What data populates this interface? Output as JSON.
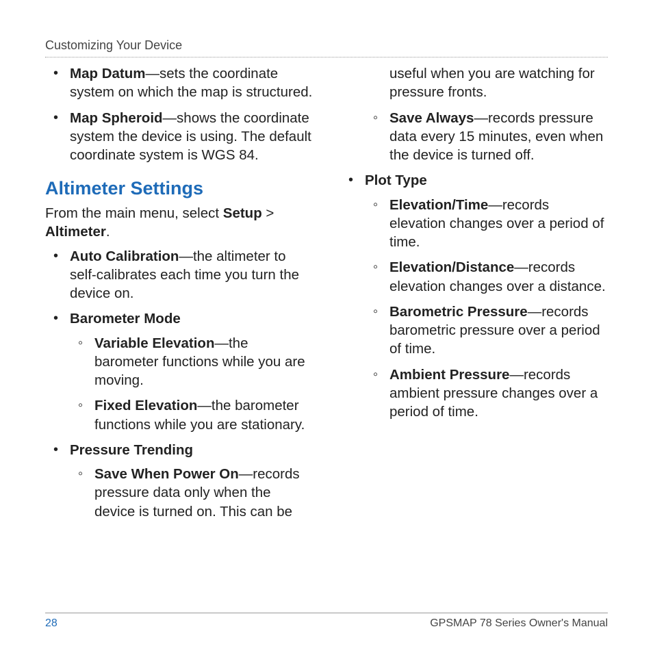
{
  "header": {
    "breadcrumb": "Customizing Your Device"
  },
  "left": {
    "map_datum_term": "Map Datum",
    "map_datum_desc": "—sets the coordinate system on which the map is structured.",
    "map_spheroid_term": "Map Spheroid",
    "map_spheroid_desc": "—shows the coordinate system the device is using. The default coordinate system is WGS 84.",
    "section_title": "Altimeter Settings",
    "intro_prefix": "From the main menu, select ",
    "intro_setup": "Setup",
    "intro_gt": " > ",
    "intro_altimeter": "Altimeter",
    "intro_period": ".",
    "auto_cal_term": "Auto Calibration",
    "auto_cal_desc": "—the altimeter to self-calibrates each time you turn the device on.",
    "baro_mode_term": "Barometer Mode",
    "var_elev_term": "Variable Elevation",
    "var_elev_desc": "—the barometer functions while you are moving.",
    "fixed_elev_term": "Fixed Elevation",
    "fixed_elev_desc": "—the barometer functions while you are stationary.",
    "press_trend_term": "Pressure Trending",
    "save_power_term": "Save When Power On",
    "save_power_desc": "—records pressure data only when the device is turned on. This can be"
  },
  "right": {
    "continuation": "useful when you are watching for pressure fronts.",
    "save_always_term": "Save Always",
    "save_always_desc": "—records pressure data every 15 minutes, even when the device is turned off.",
    "plot_type_term": "Plot Type",
    "elev_time_term": "Elevation/Time",
    "elev_time_desc": "—records elevation changes over a period of time.",
    "elev_dist_term": "Elevation/Distance",
    "elev_dist_desc": "—records elevation changes over a distance.",
    "baro_press_term": "Barometric Pressure",
    "baro_press_desc": "—records barometric pressure over a period of time.",
    "amb_press_term": "Ambient Pressure",
    "amb_press_desc": "—records ambient pressure changes over a period of time."
  },
  "footer": {
    "page_number": "28",
    "manual_title": "GPSMAP 78 Series Owner's Manual"
  }
}
